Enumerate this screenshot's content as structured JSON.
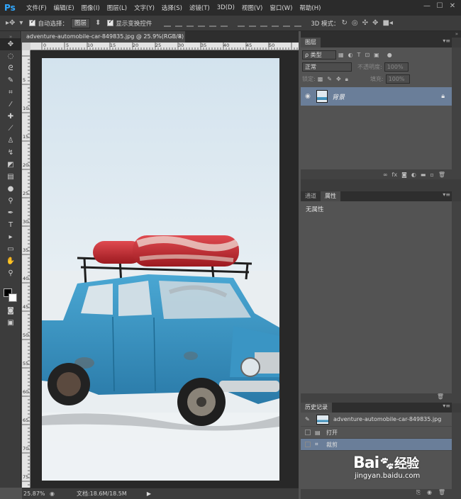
{
  "app": {
    "logo": "Ps",
    "menu": [
      "文件(F)",
      "编辑(E)",
      "图像(I)",
      "图层(L)",
      "文字(Y)",
      "选择(S)",
      "滤镜(T)",
      "3D(D)",
      "视图(V)",
      "窗口(W)",
      "帮助(H)"
    ],
    "window_controls": [
      "—",
      "☐",
      "✕"
    ]
  },
  "options_bar": {
    "auto_select_label": "自动选择：",
    "auto_select_value": "图层",
    "show_transform_label": "显示变换控件",
    "mode_3d_label": "3D 模式："
  },
  "document": {
    "tab_title": "adventure-automobile-car-849835.jpg @ 25.9%(RGB/8) *",
    "close_glyph": "×",
    "ruler_h_ticks": [
      "0",
      "5",
      "10",
      "15",
      "20",
      "25",
      "30",
      "35",
      "40",
      "45",
      "50"
    ],
    "ruler_v_ticks": [
      "5",
      "10",
      "15",
      "20",
      "25",
      "30",
      "35",
      "40",
      "45",
      "50",
      "55",
      "60",
      "65",
      "70",
      "75"
    ]
  },
  "status_bar": {
    "zoom": "25.87%",
    "doc_info": "文档:18.6M/18.5M"
  },
  "layers_panel": {
    "tab": "图层",
    "filter_kind": "ρ 类型",
    "blend_mode": "正常",
    "opacity_label": "不透明度:",
    "opacity_value": "100%",
    "lock_label": "锁定:",
    "fill_label": "填充:",
    "fill_value": "100%",
    "layers": [
      {
        "name": "背景",
        "visible": true,
        "locked": true
      }
    ]
  },
  "properties_panel": {
    "tabs": [
      "通道",
      "属性"
    ],
    "active_tab": "属性",
    "content": "无属性"
  },
  "history_panel": {
    "tab": "历史记录",
    "snapshot": "adventure-automobile-car-849835.jpg",
    "steps": [
      {
        "label": "打开",
        "selected": false
      },
      {
        "label": "裁剪",
        "selected": true
      }
    ]
  },
  "watermark": {
    "brand": "Bai",
    "brand2": "经验",
    "url": "jingyan.baidu.com"
  },
  "colors": {
    "chrome_dark": "#2b2b2b",
    "panel": "#535353",
    "selection": "#6a7e99",
    "car_blue": "#3a95c4",
    "float_red": "#c8232a"
  }
}
